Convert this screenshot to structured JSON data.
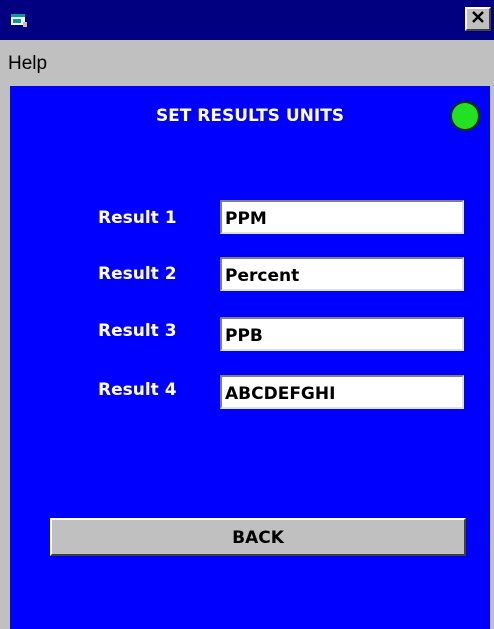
{
  "titlebar": {
    "icon": "app-window-icon",
    "close_icon": "close-icon"
  },
  "menubar": {
    "items": [
      {
        "label": "Help"
      }
    ]
  },
  "screen": {
    "title": "SET RESULTS UNITS",
    "status_led_color": "#22e022",
    "rows": [
      {
        "label": "Result 1",
        "value": "PPM"
      },
      {
        "label": "Result 2",
        "value": "Percent"
      },
      {
        "label": "Result 3",
        "value": "PPB"
      },
      {
        "label": "Result 4",
        "value": "ABCDEFGHI"
      }
    ],
    "back_label": "BACK"
  },
  "colors": {
    "titlebar": "#000080",
    "client_background": "#0000ff",
    "chrome": "#c0c0c0"
  }
}
